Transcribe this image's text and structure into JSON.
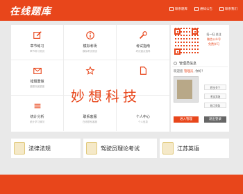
{
  "header": {
    "logo": "在线题库",
    "links": [
      "联系题库",
      "通知公告",
      "联系我们"
    ]
  },
  "tiles": [
    {
      "title": "章节练习",
      "sub": "章节练习测试",
      "icon": "edit-icon"
    },
    {
      "title": "模拟考场",
      "sub": "模拟考试测试",
      "icon": "info-icon"
    },
    {
      "title": "考试指南",
      "sub": "考试重点指导",
      "icon": "wrench-icon"
    },
    {
      "title": "错题重做",
      "sub": "错题巩固重做",
      "icon": "mail-icon"
    },
    {
      "title": "",
      "sub": "",
      "icon": "star-icon"
    },
    {
      "title": "",
      "sub": "",
      "icon": "document-icon"
    },
    {
      "title": "统计分析",
      "sub": "统计学习情况",
      "icon": "chart-icon"
    },
    {
      "title": "联系客服",
      "sub": "在线联系客服",
      "icon": "service-icon"
    },
    {
      "title": "个人中心",
      "sub": "个人信息",
      "icon": "user-icon"
    }
  ],
  "side": {
    "qr_caption": [
      "扫一扫 关注",
      "微信公众号",
      "免费学习"
    ],
    "admin_title": "管理员信息",
    "welcome_prefix": "欢迎您",
    "welcome_name": "管理员",
    "welcome_suffix": ", 你好！",
    "badges": [
      "积分0个",
      "考试0场",
      "练习0条"
    ],
    "enter_btn": "进入管理",
    "exit_btn": "退出登录"
  },
  "watermark": "妙想科技",
  "bottom": [
    {
      "label": "法律法规"
    },
    {
      "label": "驾驶员理论考试"
    },
    {
      "label": "江苏英语"
    }
  ],
  "colors": {
    "accent": "#e8461b"
  }
}
